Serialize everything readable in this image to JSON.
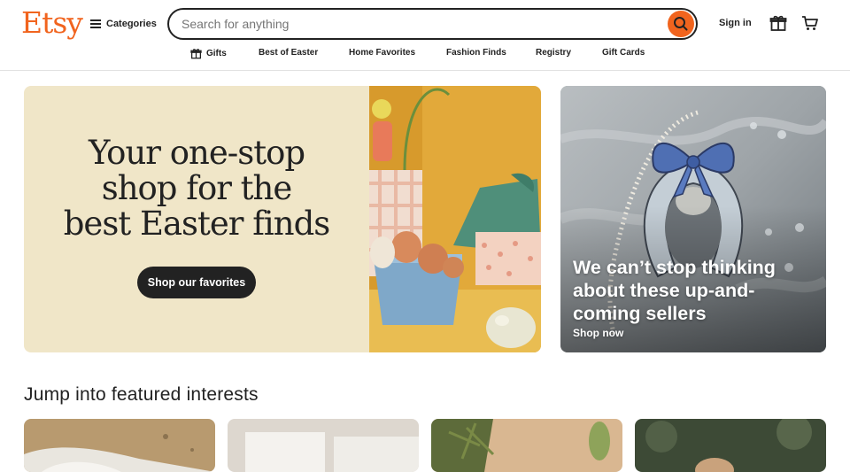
{
  "header": {
    "logo": "Etsy",
    "categories_label": "Categories",
    "search_placeholder": "Search for anything",
    "sign_in": "Sign in"
  },
  "nav": {
    "items": [
      {
        "label": "Gifts",
        "icon": "gift-icon"
      },
      {
        "label": "Best of Easter"
      },
      {
        "label": "Home Favorites"
      },
      {
        "label": "Fashion Finds"
      },
      {
        "label": "Registry"
      },
      {
        "label": "Gift Cards"
      }
    ]
  },
  "hero": {
    "left": {
      "line1": "Your one-stop",
      "line2": "shop for the",
      "line3": "best Easter finds",
      "button": "Shop our favorites"
    },
    "right": {
      "title": "We can’t stop thinking about these up-and-coming sellers",
      "link": "Shop now"
    }
  },
  "featured": {
    "title": "Jump into featured interests"
  },
  "colors": {
    "brand": "#f1641e",
    "hero_bg": "#f0e6c8",
    "dark": "#222222"
  }
}
